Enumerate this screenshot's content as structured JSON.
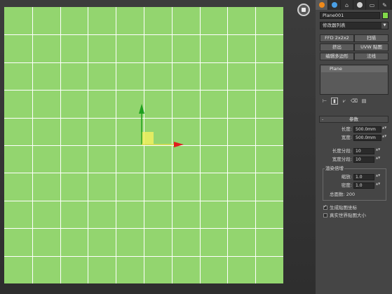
{
  "viewport": {
    "background": "#93d56f",
    "grid_color": "#ffffff",
    "grid_divisions": 10,
    "gizmo": {
      "x_axis_color": "#e01e1e",
      "y_axis_color": "#1fa01f",
      "plane_color": "#f0f060",
      "x_label": "x",
      "y_label": "y"
    },
    "nav_icon": "viewcube-icon"
  },
  "command_panel": {
    "tabs": [
      {
        "icon": "create-icon",
        "color": "#f08a1a"
      },
      {
        "icon": "modify-icon",
        "color": "#4aa0e6"
      },
      {
        "icon": "hierarchy-icon",
        "color": "#bdbdbd"
      },
      {
        "icon": "motion-icon",
        "color": "#d0d0d0"
      },
      {
        "icon": "display-icon",
        "color": "#cfcfcf"
      },
      {
        "icon": "utilities-icon",
        "color": "#cfcfcf"
      }
    ],
    "object_name": "Plane001",
    "object_color": "#82d94a",
    "modifier_list": "修改器列表",
    "modifier_buttons": [
      "FFD 2x2x2",
      "扫描",
      "挤出",
      "UVW 贴图",
      "编辑多边形",
      "法线"
    ],
    "stack_items": [
      "Plane"
    ]
  },
  "params": {
    "title": "参数",
    "minus": "-",
    "length_label": "长度:",
    "length_value": "500.0mm",
    "width_label": "宽度:",
    "width_value": "500.0mm",
    "length_segs_label": "长度分段:",
    "length_segs_value": "10",
    "width_segs_label": "宽度分段:",
    "width_segs_value": "10",
    "render_group": "渲染倍增",
    "scale_label": "缩放:",
    "scale_value": "1.0",
    "density_label": "密度:",
    "density_value": "1.0",
    "total_faces": "总面数: 200",
    "gen_uv_label": "生成贴图坐标",
    "gen_uv_checked": true,
    "real_world_label": "真实世界贴图大小",
    "real_world_checked": false
  }
}
